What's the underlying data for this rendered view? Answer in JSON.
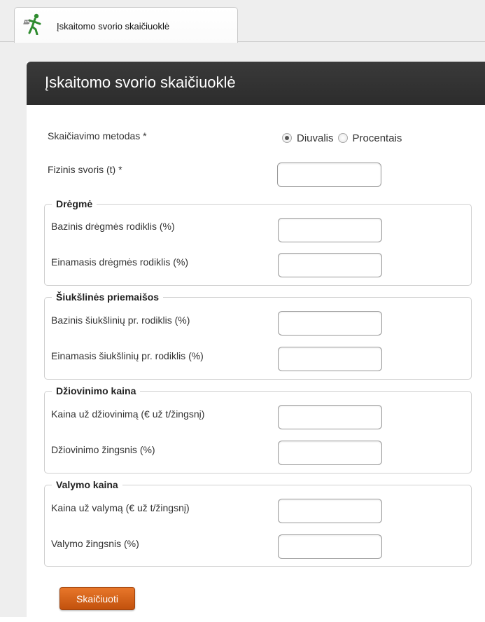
{
  "tab": {
    "label": "Įskaitomo svorio skaičiuoklė",
    "icon": "scale-figure-icon"
  },
  "panel": {
    "title": "Įskaitomo svorio skaičiuoklė"
  },
  "method": {
    "label": "Skaičiavimo metodas *",
    "options": [
      {
        "label": "Diuvalis",
        "selected": true
      },
      {
        "label": "Procentais",
        "selected": false
      }
    ]
  },
  "physical_weight": {
    "label": "Fizinis svoris (t) *",
    "value": ""
  },
  "groups": [
    {
      "legend": "Drėgmė",
      "fields": [
        {
          "label": "Bazinis drėgmės rodiklis (%)",
          "value": ""
        },
        {
          "label": "Einamasis drėgmės rodiklis (%)",
          "value": ""
        }
      ]
    },
    {
      "legend": "Šiukšlinės priemaišos",
      "fields": [
        {
          "label": "Bazinis šiukšlinių pr. rodiklis (%)",
          "value": ""
        },
        {
          "label": "Einamasis šiukšlinių pr. rodiklis (%)",
          "value": ""
        }
      ]
    },
    {
      "legend": "Džiovinimo kaina",
      "fields": [
        {
          "label": "Kaina už džiovinimą (€ už t/žingsnį)",
          "value": ""
        },
        {
          "label": "Džiovinimo žingsnis (%)",
          "value": ""
        }
      ]
    },
    {
      "legend": "Valymo kaina",
      "fields": [
        {
          "label": "Kaina už valymą (€ už t/žingsnį)",
          "value": ""
        },
        {
          "label": "Valymo žingsnis (%)",
          "value": ""
        }
      ]
    }
  ],
  "submit": {
    "label": "Skaičiuoti"
  },
  "colors": {
    "header_bg": "#2f2f2f",
    "button_accent": "#d9621b",
    "page_bg": "#eeeeee"
  }
}
